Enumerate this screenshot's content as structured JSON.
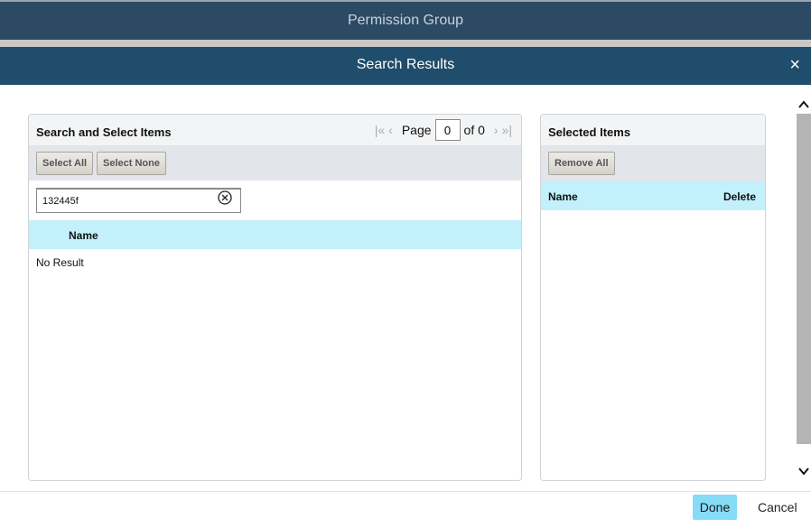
{
  "background": {
    "title": "Permission Group"
  },
  "modal": {
    "title": "Search Results",
    "close_symbol": "×"
  },
  "left_panel": {
    "title": "Search and Select Items",
    "select_all_label": "Select All",
    "select_none_label": "Select None",
    "search_value": "132445f",
    "column_name": "Name",
    "empty_text": "No Result",
    "pager": {
      "first_symbol": "|«",
      "prev_symbol": "‹",
      "page_label": "Page",
      "page_value": "0",
      "of_label": "of 0",
      "next_symbol": "›",
      "last_symbol": "»|"
    }
  },
  "right_panel": {
    "title": "Selected Items",
    "remove_all_label": "Remove All",
    "column_name": "Name",
    "column_delete": "Delete"
  },
  "footer": {
    "done_label": "Done",
    "cancel_label": "Cancel"
  },
  "colors": {
    "header_bg": "#1f4d6b",
    "column_header_bg": "#c2f0fb",
    "done_button_bg": "#86dbf6"
  },
  "icons": [
    "close-icon",
    "clear-search-icon",
    "first-page-icon",
    "prev-page-icon",
    "next-page-icon",
    "last-page-icon",
    "scroll-up-icon",
    "scroll-down-icon"
  ]
}
